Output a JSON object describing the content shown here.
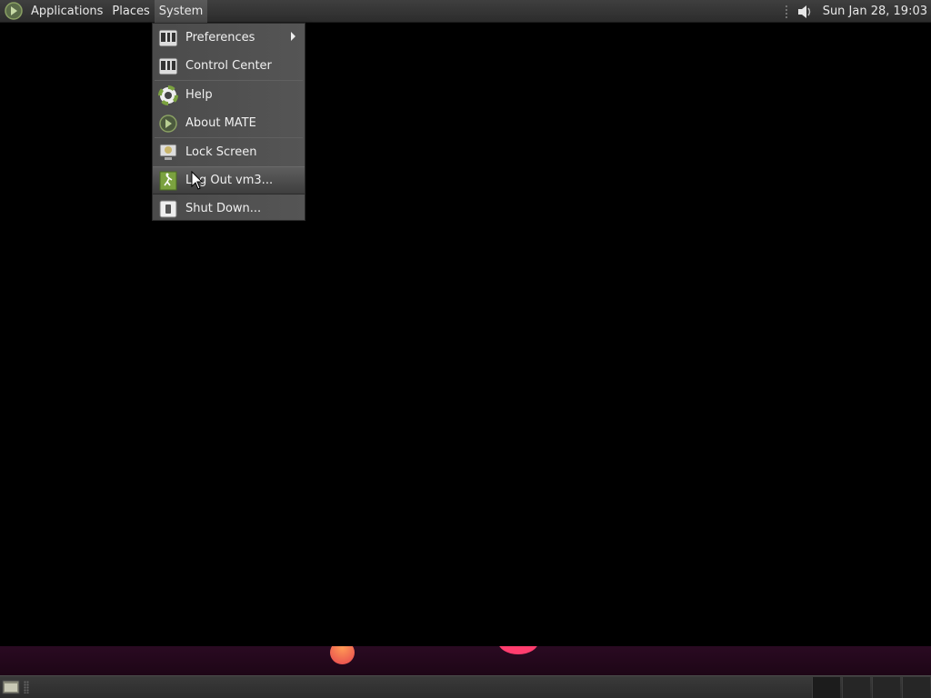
{
  "top_panel": {
    "menus": [
      {
        "label": "Applications"
      },
      {
        "label": "Places"
      },
      {
        "label": "System"
      }
    ],
    "clock": "Sun Jan 28, 19:03"
  },
  "system_menu": {
    "items": [
      {
        "label": "Preferences",
        "icon": "preferences-icon",
        "submenu": true
      },
      {
        "label": "Control Center",
        "icon": "control-center-icon"
      },
      {
        "label": "Help",
        "icon": "help-lifebuoy-icon"
      },
      {
        "label": "About MATE",
        "icon": "mate-logo-icon"
      },
      {
        "label": "Lock Screen",
        "icon": "lock-screen-icon"
      },
      {
        "label": "Log Out vm3...",
        "icon": "logout-icon",
        "highlighted": true
      },
      {
        "label": "Shut Down...",
        "icon": "shutdown-icon"
      }
    ]
  },
  "colors": {
    "panel": "#333333",
    "menu_bg": "#4f4f4f",
    "desktop": "#000000",
    "accent_green": "#7ba23f"
  }
}
